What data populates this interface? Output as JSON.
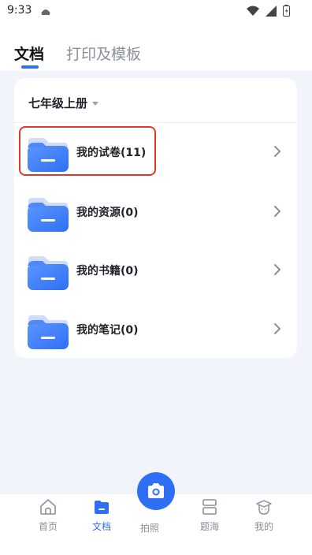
{
  "status_bar": {
    "time": "9:33"
  },
  "header": {
    "tabs": [
      {
        "label": "文档",
        "active": true
      },
      {
        "label": "打印及模板",
        "active": false
      }
    ]
  },
  "card": {
    "grade_selector": "七年级上册",
    "folders": [
      {
        "label": "我的试卷(11)",
        "icon": "folder-icon",
        "highlighted": true
      },
      {
        "label": "我的资源(0)",
        "icon": "folder-icon",
        "highlighted": false
      },
      {
        "label": "我的书籍(0)",
        "icon": "folder-icon",
        "highlighted": false
      },
      {
        "label": "我的笔记(0)",
        "icon": "folder-icon",
        "highlighted": false
      }
    ]
  },
  "bottom_nav": {
    "items": [
      {
        "label": "首页",
        "icon": "home-icon",
        "active": false
      },
      {
        "label": "文档",
        "icon": "document-folder-icon",
        "active": true
      },
      {
        "label": "拍照",
        "icon": "camera-icon",
        "active": false
      },
      {
        "label": "题海",
        "icon": "question-bank-icon",
        "active": false
      },
      {
        "label": "我的",
        "icon": "profile-icon",
        "active": false
      }
    ]
  },
  "colors": {
    "accent": "#2f6ff5",
    "highlight_border": "#e0392c",
    "background": "#f1f4fa"
  }
}
